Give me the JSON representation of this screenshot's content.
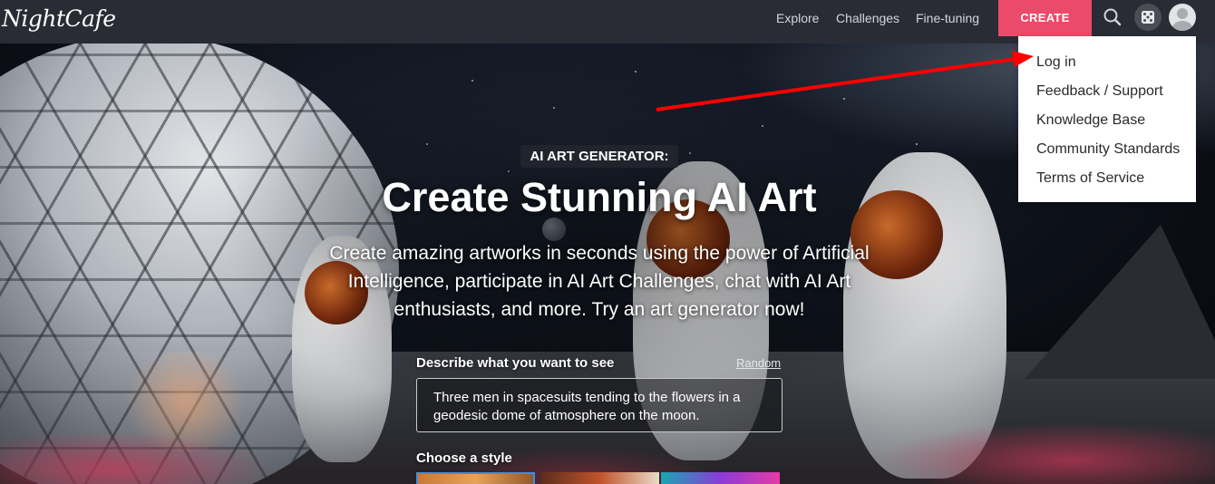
{
  "brand": {
    "logo_text": "NightCafe"
  },
  "nav": {
    "links": [
      "Explore",
      "Challenges",
      "Fine-tuning"
    ],
    "create_label": "CREATE",
    "icons": [
      "search-icon",
      "dice-icon",
      "user-avatar-icon"
    ],
    "accent_color": "#ec4a6a"
  },
  "dropdown": {
    "items": [
      "Log in",
      "Feedback / Support",
      "Knowledge Base",
      "Community Standards",
      "Terms of Service"
    ]
  },
  "hero": {
    "badge": "AI ART GENERATOR:",
    "headline": "Create Stunning AI Art",
    "subtitle": "Create amazing artworks in seconds using the power of Artificial Intelligence, participate in AI Art Challenges, chat with AI Art enthusiasts, and more. Try an art generator now!"
  },
  "prompt": {
    "label": "Describe what you want to see",
    "random_label": "Random",
    "value": "Three men in spacesuits tending to the flowers in a geodesic dome of atmosphere on the moon."
  },
  "style": {
    "label": "Choose a style"
  },
  "annotation": {
    "arrow_color": "#ff0000"
  }
}
